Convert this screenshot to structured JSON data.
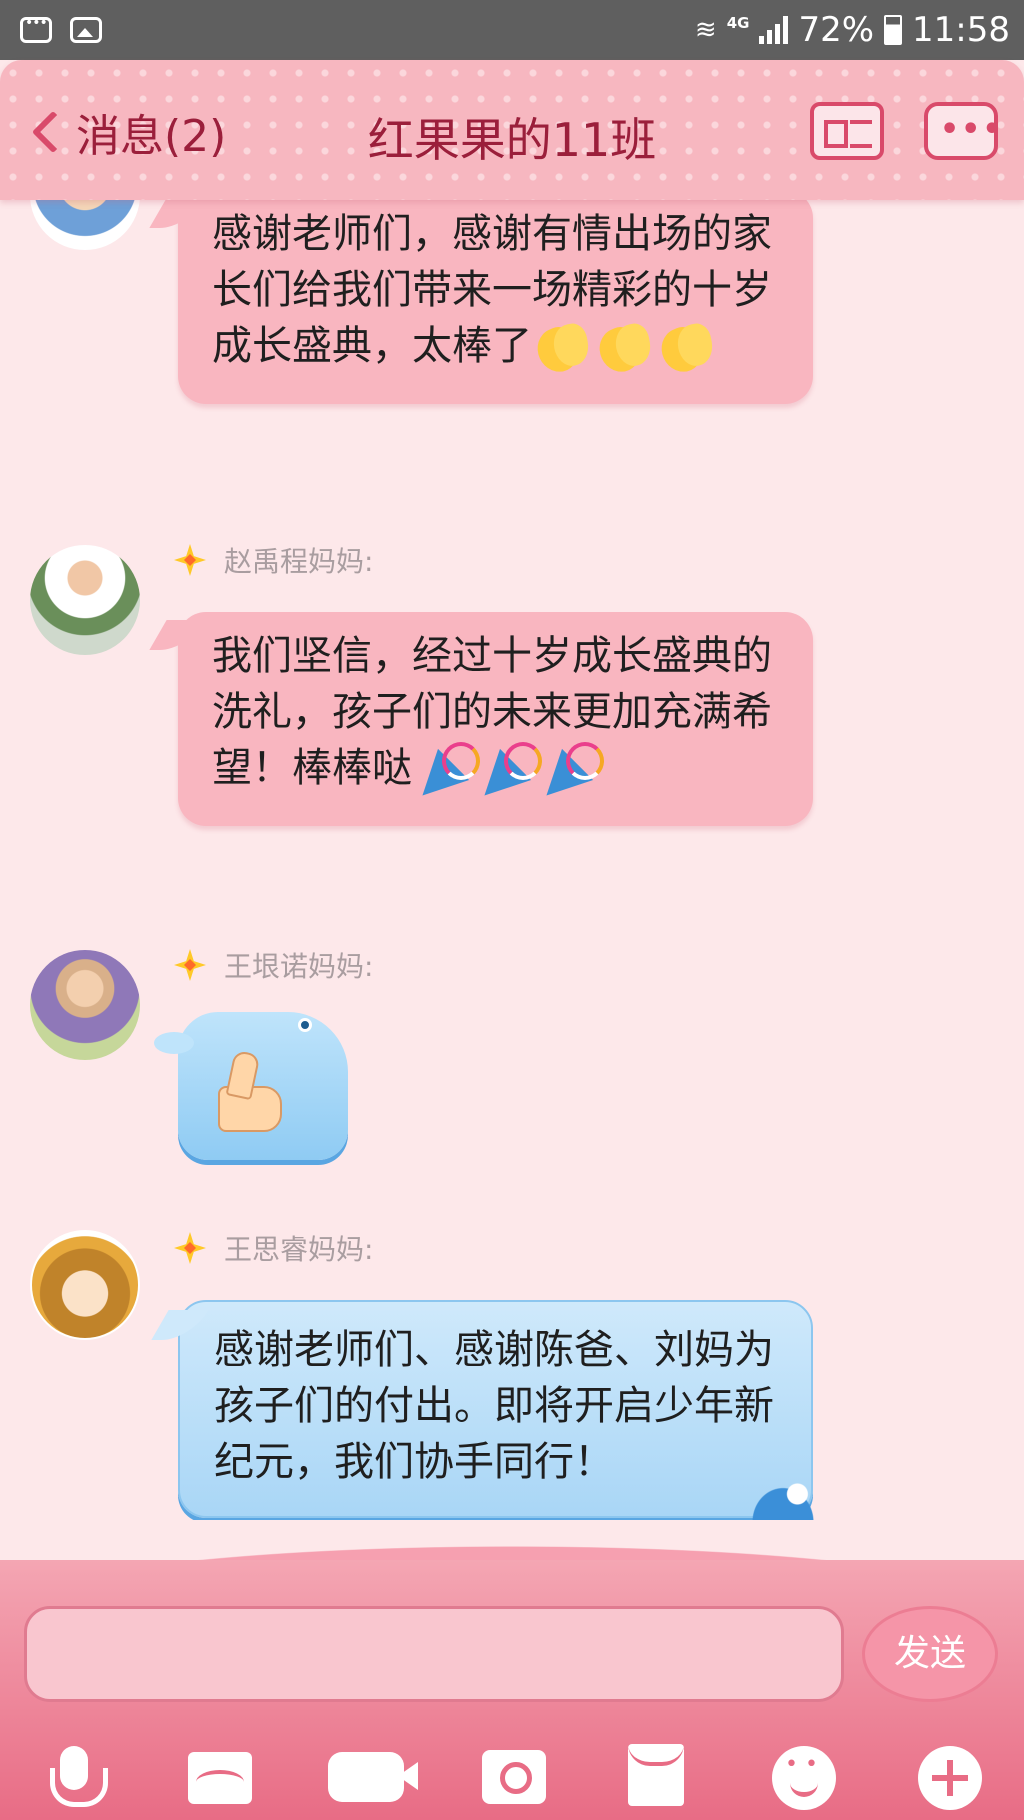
{
  "status_bar": {
    "network": "4G",
    "battery": "72%",
    "time": "11:58"
  },
  "header": {
    "back_label": "消息(2)",
    "title": "红果果的11班"
  },
  "messages": [
    {
      "text": "感谢老师们，感谢有情出场的家长们给我们带来一场精彩的十岁成长盛典，太棒了",
      "emojis": [
        "clap",
        "clap",
        "clap"
      ],
      "style": "pink"
    },
    {
      "sender": "赵禹程妈妈:",
      "text": "我们坚信，经过十岁成长盛典的洗礼，孩子们的未来更加充满希望！棒棒哒",
      "emojis": [
        "party-popper",
        "party-popper",
        "party-popper"
      ],
      "style": "pink"
    },
    {
      "sender": "王垠诺妈妈:",
      "sticker": "thumbs-up",
      "style": "blue-sticker"
    },
    {
      "sender": "王思睿妈妈:",
      "text": "感谢老师们、感谢陈爸、刘妈为孩子们的付出。即将开启少年新纪元，我们协手同行！",
      "style": "blue"
    }
  ],
  "composer": {
    "input_value": "",
    "send_label": "发送"
  },
  "toolbar_icons": [
    "microphone-icon",
    "photo-icon",
    "video-icon",
    "camera-icon",
    "envelope-icon",
    "emoji-icon",
    "plus-icon"
  ],
  "colors": {
    "header_bg": "#f7b7c0",
    "accent": "#d94a6a",
    "pink_bubble": "#f9b6c0",
    "blue_bubble": "#a9d6f6",
    "background": "#fde8ea"
  }
}
